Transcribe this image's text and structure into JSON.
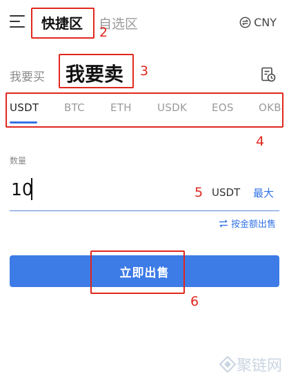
{
  "header": {
    "tab_quick": "快捷区",
    "tab_optional": "自选区",
    "currency": "CNY"
  },
  "mode": {
    "buy": "我要买",
    "sell": "我要卖"
  },
  "coin_tabs": [
    "USDT",
    "BTC",
    "ETH",
    "USDK",
    "EOS",
    "OKB"
  ],
  "quantity": {
    "label": "数量",
    "value": "10",
    "unit": "USDT",
    "max": "最大",
    "switch_mode": "按金额出售"
  },
  "action": {
    "sell_button": "立即出售"
  },
  "annotations": [
    "2",
    "3",
    "4",
    "5",
    "6"
  ],
  "watermark": "聚链网",
  "colors": {
    "accent": "#3373e5",
    "button": "#3d7be6",
    "annotation": "#e0261c"
  }
}
